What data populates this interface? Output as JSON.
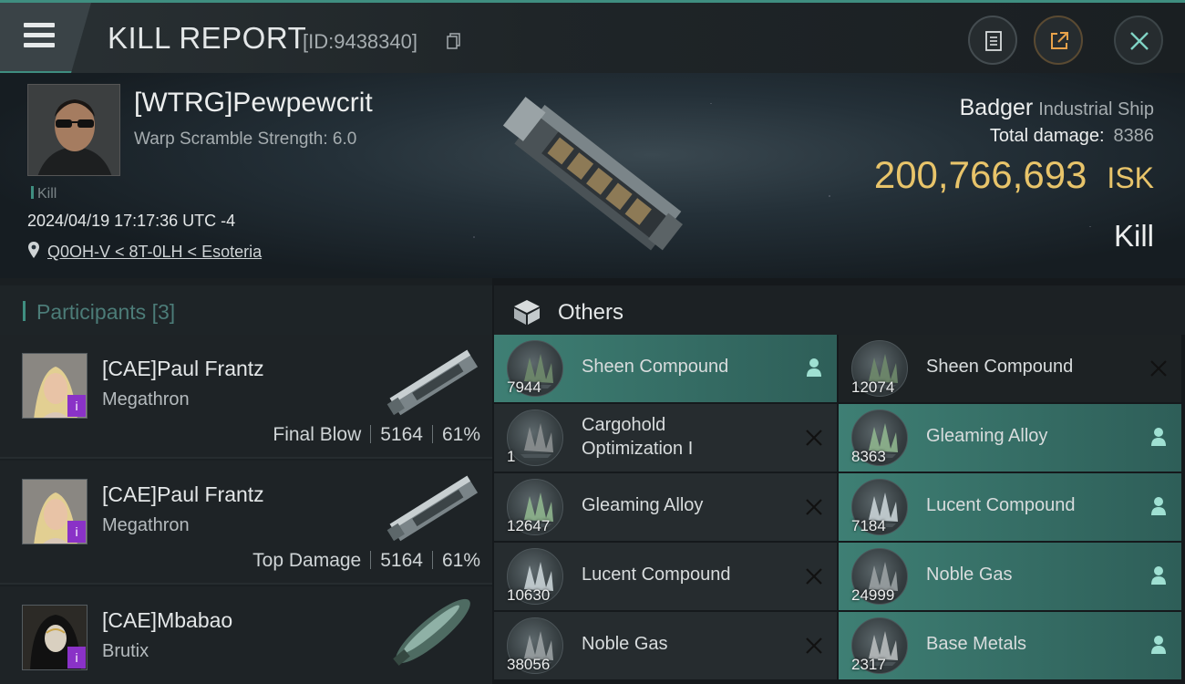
{
  "header": {
    "title": "KILL REPORT",
    "id_text": "[ID:9438340]"
  },
  "victim": {
    "name": "[WTRG]Pewpewcrit",
    "subtitle": "Warp Scramble Strength: 6.0",
    "tag": "Kill",
    "datetime": "2024/04/19 17:17:36 UTC -4",
    "location": "Q0OH-V < 8T-0LH < Esoteria",
    "ship": "Badger",
    "ship_class": "Industrial Ship",
    "total_damage_label": "Total damage:",
    "total_damage": "8386",
    "isk_value": "200,766,693",
    "isk_unit": "ISK",
    "result": "Kill"
  },
  "participants": {
    "label": "Participants",
    "count": "[3]",
    "rows": [
      {
        "name": "[CAE]Paul Frantz",
        "ship": "Megathron",
        "role": "Final Blow",
        "damage": "5164",
        "percent": "61%"
      },
      {
        "name": "[CAE]Paul Frantz",
        "ship": "Megathron",
        "role": "Top Damage",
        "damage": "5164",
        "percent": "61%"
      },
      {
        "name": "[CAE]Mbabao",
        "ship": "Brutix",
        "role": "",
        "damage": "",
        "percent": ""
      }
    ]
  },
  "others": {
    "label": "Others",
    "items": [
      {
        "name": "Sheen Compound",
        "qty": "7944",
        "status": "dropped"
      },
      {
        "name": "Sheen Compound",
        "qty": "12074",
        "status": "destroyed"
      },
      {
        "name": "Cargohold Optimization I",
        "qty": "1",
        "status": "destroyed"
      },
      {
        "name": "Gleaming Alloy",
        "qty": "8363",
        "status": "dropped"
      },
      {
        "name": "Gleaming Alloy",
        "qty": "12647",
        "status": "destroyed"
      },
      {
        "name": "Lucent Compound",
        "qty": "7184",
        "status": "dropped"
      },
      {
        "name": "Lucent Compound",
        "qty": "10630",
        "status": "destroyed"
      },
      {
        "name": "Noble Gas",
        "qty": "24999",
        "status": "dropped"
      },
      {
        "name": "Noble Gas",
        "qty": "38056",
        "status": "destroyed"
      },
      {
        "name": "Base Metals",
        "qty": "2317",
        "status": "dropped"
      }
    ]
  },
  "colors": {
    "accent": "#3f8e80",
    "isk": "#e8c46a",
    "dropped": "#3e7f74",
    "badge": "#8a32c7"
  }
}
